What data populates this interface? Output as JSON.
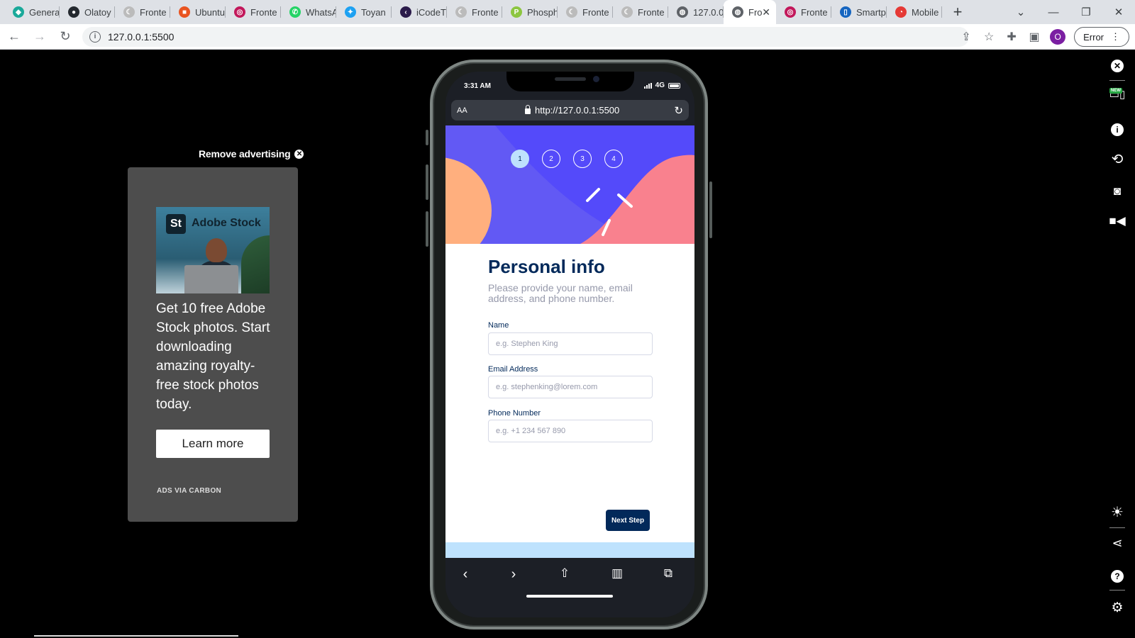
{
  "browser": {
    "tabs": [
      {
        "title": "Genera",
        "favicon_color": "#1aa99a",
        "favicon_glyph": "◆"
      },
      {
        "title": "Olatoy",
        "favicon_color": "#24292f",
        "favicon_glyph": "●"
      },
      {
        "title": "Fronte",
        "favicon_color": "#bbbbbb",
        "favicon_glyph": "☾"
      },
      {
        "title": "Ubuntu",
        "favicon_color": "#e95420",
        "favicon_glyph": "■"
      },
      {
        "title": "Fronte",
        "favicon_color": "#c2185b",
        "favicon_glyph": "◎"
      },
      {
        "title": "WhatsA",
        "favicon_color": "#25d366",
        "favicon_glyph": "✆"
      },
      {
        "title": "Toyan",
        "favicon_color": "#1da1f2",
        "favicon_glyph": "✦"
      },
      {
        "title": "iCodeT",
        "favicon_color": "#2b1b4a",
        "favicon_glyph": "‹"
      },
      {
        "title": "Fronte",
        "favicon_color": "#bbbbbb",
        "favicon_glyph": "☾"
      },
      {
        "title": "Phosph",
        "favicon_color": "#8cc63f",
        "favicon_glyph": "P"
      },
      {
        "title": "Fronte",
        "favicon_color": "#bbbbbb",
        "favicon_glyph": "☾"
      },
      {
        "title": "Fronte",
        "favicon_color": "#bbbbbb",
        "favicon_glyph": "☾"
      },
      {
        "title": "127.0.0",
        "favicon_color": "#5f6368",
        "favicon_glyph": "◍"
      },
      {
        "title": "Fro",
        "favicon_color": "#5f6368",
        "favicon_glyph": "◍",
        "active": true
      },
      {
        "title": "Fronte",
        "favicon_color": "#c2185b",
        "favicon_glyph": "◎"
      },
      {
        "title": "Smartp",
        "favicon_color": "#1565c0",
        "favicon_glyph": "▯"
      },
      {
        "title": "Mobile",
        "favicon_color": "#e53935",
        "favicon_glyph": "◔"
      }
    ],
    "url": "127.0.0.1:5500",
    "error_button": "Error",
    "profile_initial": "O"
  },
  "ad": {
    "remove_label": "Remove advertising",
    "image_logo": "St",
    "image_brand": "Adobe Stock",
    "text": "Get 10 free Adobe Stock photos. Start downloading amazing royalty-free stock photos today.",
    "cta": "Learn more",
    "attribution": "ADS VIA CARBON"
  },
  "phone": {
    "status_time": "3:31 AM",
    "network": "4G",
    "urlbar_aa": "AA",
    "urlbar_url": "http://127.0.0.1:5500",
    "steps": [
      "1",
      "2",
      "3",
      "4"
    ],
    "active_step": 1,
    "form": {
      "title": "Personal info",
      "subtitle": "Please provide your name, email address, and phone number.",
      "fields": [
        {
          "label": "Name",
          "placeholder": "e.g. Stephen King",
          "value": ""
        },
        {
          "label": "Email Address",
          "placeholder": "e.g. stephenking@lorem.com",
          "value": ""
        },
        {
          "label": "Phone Number",
          "placeholder": "e.g. +1 234 567 890",
          "value": ""
        }
      ],
      "next_button": "Next Step"
    }
  },
  "colors": {
    "marine_blue": "#02295a",
    "hero_purple": "#6259f4",
    "hero_orange": "#ffaf7e",
    "hero_pink": "#f9818e",
    "light_blue": "#bee2fd",
    "cool_gray": "#9699ab"
  }
}
